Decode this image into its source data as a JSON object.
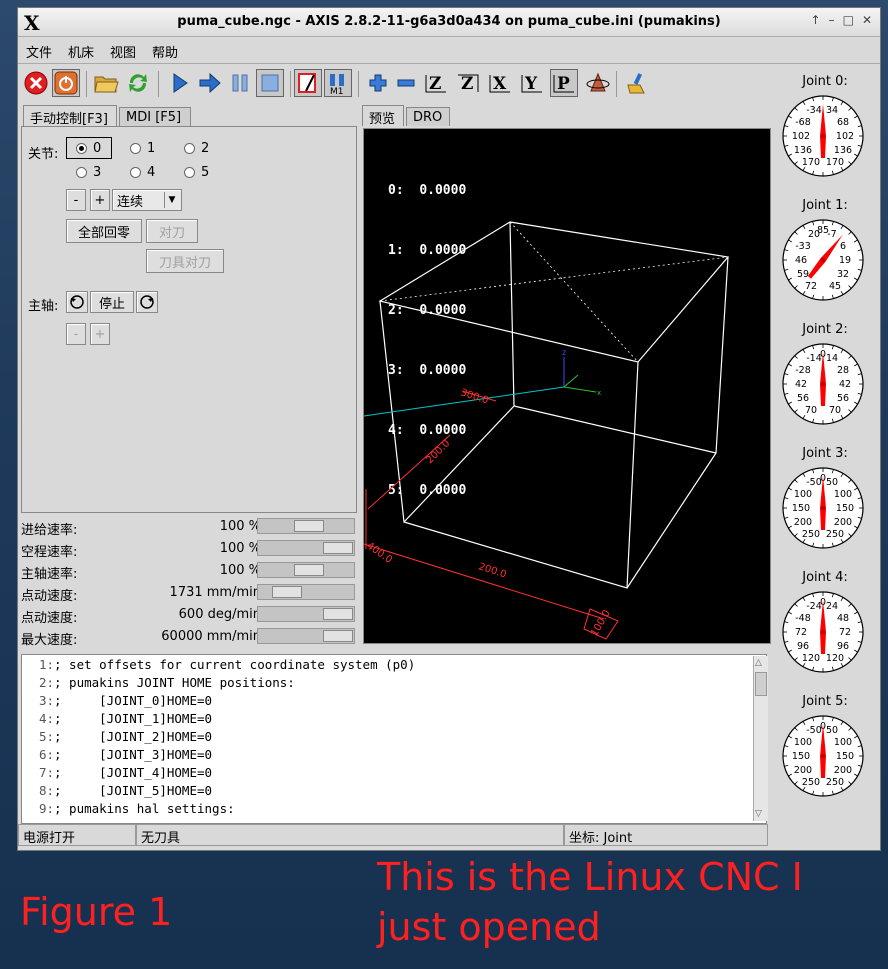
{
  "window": {
    "title": "puma_cube.ngc - AXIS 2.8.2-11-g6a3d0a434 on puma_cube.ini (pumakins)",
    "controls": [
      "↑",
      "–",
      "□",
      "✕"
    ]
  },
  "menu": [
    "文件",
    "机床",
    "视图",
    "帮助"
  ],
  "toolbar": {
    "icons": [
      "estop-icon",
      "power-icon",
      "open-file-icon",
      "reload-icon",
      "run-icon",
      "step-icon",
      "pause-icon",
      "stop-icon",
      "block-delete-icon",
      "optional-stop-icon",
      "zoom-in-icon",
      "zoom-out-icon",
      "view-z-icon",
      "view-z2-icon",
      "view-x-icon",
      "view-y-icon",
      "view-p-icon",
      "rotate-icon",
      "clear-plot-icon"
    ],
    "view_letters": {
      "z": "Z",
      "z2": "Z",
      "x": "X",
      "y": "Y",
      "p": "P"
    },
    "m1_label": "M1"
  },
  "left_tabs": [
    "手动控制[F3]",
    "MDI [F5]"
  ],
  "manual": {
    "joint_label": "关节:",
    "joints": [
      "0",
      "1",
      "2",
      "3",
      "4",
      "5"
    ],
    "selected_joint": "0",
    "minus": "-",
    "plus": "+",
    "jog_mode": "连续",
    "home_all": "全部回零",
    "touch_off": "对刀",
    "tool_touch_off": "刀具对刀",
    "spindle_label": "主轴:",
    "spindle_stop": "停止",
    "spindle_minus": "-",
    "spindle_plus": "+"
  },
  "sliders": [
    {
      "name": "进给速率:",
      "value": "100 %",
      "level": 0.55
    },
    {
      "name": "空程速率:",
      "value": "100 %",
      "level": 1.0
    },
    {
      "name": "主轴速率:",
      "value": "100 %",
      "level": 0.55
    },
    {
      "name": "点动速度:",
      "value": "1731 mm/min",
      "level": 0.2
    },
    {
      "name": "点动速度:",
      "value": "600 deg/min",
      "level": 1.0
    },
    {
      "name": "最大速度:",
      "value": "60000 mm/min",
      "level": 1.0
    }
  ],
  "preview_tabs": [
    "预览",
    "DRO"
  ],
  "dro": [
    {
      "axis": "0:",
      "value": "0.0000"
    },
    {
      "axis": "1:",
      "value": "0.0000"
    },
    {
      "axis": "2:",
      "value": "0.0000"
    },
    {
      "axis": "3:",
      "value": "0.0000"
    },
    {
      "axis": "4:",
      "value": "0.0000"
    },
    {
      "axis": "5:",
      "value": "0.0000"
    }
  ],
  "dimension_labels": {
    "top": "300.0",
    "diag": "200.0",
    "left": "400.0",
    "bottom": "200.0",
    "corner": "100.0"
  },
  "joints": [
    {
      "title": "Joint 0:",
      "labels": [
        "-34",
        "34",
        "-68",
        "68",
        "102",
        "102",
        "136",
        "136",
        "170",
        "170"
      ]
    },
    {
      "title": "Joint 1:",
      "labels": [
        "20",
        "-7",
        "-33",
        "6",
        "46",
        "19",
        "59",
        "32",
        "72",
        "45",
        "85"
      ]
    },
    {
      "title": "Joint 2:",
      "labels": [
        "-14",
        "14",
        "-28",
        "28",
        "42",
        "42",
        "56",
        "56",
        "70",
        "70",
        "0"
      ]
    },
    {
      "title": "Joint 3:",
      "labels": [
        "-50",
        "50",
        "100",
        "100",
        "150",
        "150",
        "200",
        "200",
        "250",
        "250",
        "0"
      ]
    },
    {
      "title": "Joint 4:",
      "labels": [
        "-24",
        "24",
        "-48",
        "48",
        "72",
        "72",
        "96",
        "96",
        "120",
        "120",
        "0"
      ]
    },
    {
      "title": "Joint 5:",
      "labels": [
        "-50",
        "50",
        "100",
        "100",
        "150",
        "150",
        "200",
        "200",
        "250",
        "250",
        "0"
      ]
    }
  ],
  "code": [
    {
      "n": "1:",
      "text": "; set offsets for current coordinate system (p0)"
    },
    {
      "n": "2:",
      "text": "; pumakins JOINT HOME positions:"
    },
    {
      "n": "3:",
      "text": ";     [JOINT_0]HOME=0"
    },
    {
      "n": "4:",
      "text": ";     [JOINT_1]HOME=0"
    },
    {
      "n": "5:",
      "text": ";     [JOINT_2]HOME=0"
    },
    {
      "n": "6:",
      "text": ";     [JOINT_3]HOME=0"
    },
    {
      "n": "7:",
      "text": ";     [JOINT_4]HOME=0"
    },
    {
      "n": "8:",
      "text": ";     [JOINT_5]HOME=0"
    },
    {
      "n": "9:",
      "text": "; pumakins hal settings:"
    }
  ],
  "status": {
    "power": "电源打开",
    "tool": "无刀具",
    "coords": "坐标: Joint"
  },
  "annotations": {
    "figure": "Figure  1",
    "note": "This is the Linux CNC I just opened"
  },
  "colors": {
    "annotation": "#ff2020",
    "preview_bg": "#000000",
    "dimension": "#ff3030",
    "needle": "#ff0000",
    "path_cyan": "#00c8c8"
  }
}
